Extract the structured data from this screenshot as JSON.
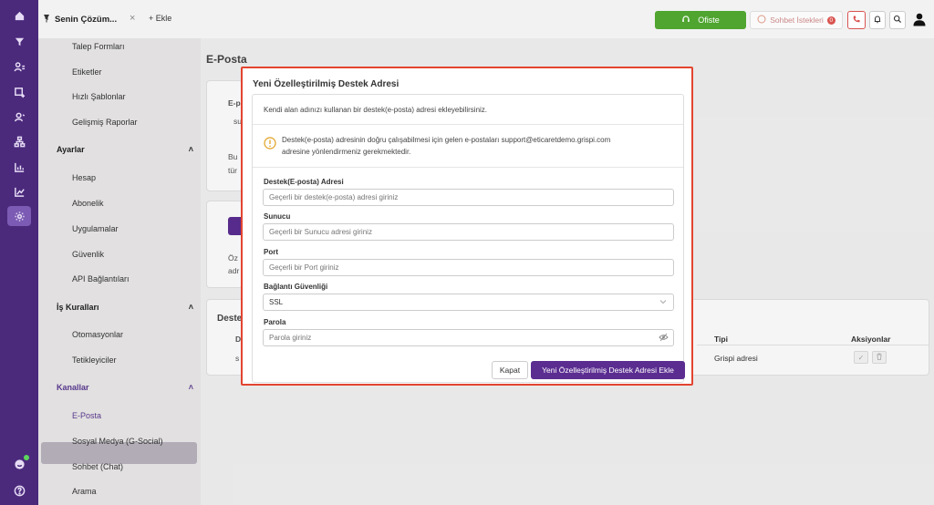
{
  "topbar": {
    "tab_title": "Senin Çözüm...",
    "tab_add": "+ Ekle",
    "ofiste_label": "Ofiste",
    "sohbet_label": "Sohbet İstekleri",
    "sohbet_count": "0"
  },
  "sidebar": {
    "items_top": [
      "Talep Formları",
      "Etiketler",
      "Hızlı Şablonlar",
      "Gelişmiş Raporlar"
    ],
    "section_ayarlar": "Ayarlar",
    "items_ayarlar": [
      "Hesap",
      "Abonelik",
      "Uygulamalar",
      "Güvenlik",
      "API Bağlantıları"
    ],
    "section_kurallar": "İş Kuralları",
    "items_kurallar": [
      "Otomasyonlar",
      "Tetikleyiciler"
    ],
    "section_kanallar": "Kanallar",
    "items_kanallar": [
      "E-Posta",
      "Sosyal Medya (G-Social)",
      "Sohbet (Chat)",
      "Arama"
    ]
  },
  "content": {
    "title": "E-Posta",
    "table_heading": "Deste",
    "col_tipi": "Tipi",
    "col_aksiyonlar": "Aksiyonlar",
    "row_tipi": "Grispi adresi",
    "partials": [
      "E-p",
      "su",
      "Bu",
      "tür",
      "Öz",
      "adr",
      "D",
      "s"
    ]
  },
  "modal": {
    "title": "Yeni Özelleştirilmiş Destek Adresi",
    "description": "Kendi alan adınızı kullanan bir destek(e-posta) adresi ekleyebilirsiniz.",
    "warning_line1": "Destek(e-posta) adresinin doğru çalışabilmesi için gelen e-postaları support@eticaretdemo.grispi.com",
    "warning_line2": "adresine yönlendirmeniz gerekmektedir.",
    "address_label": "Destek(E-posta) Adresi",
    "address_placeholder": "Geçerli bir destek(e-posta) adresi giriniz",
    "server_label": "Sunucu",
    "server_placeholder": "Geçerli bir Sunucu adresi giriniz",
    "port_label": "Port",
    "port_placeholder": "Geçerli bir Port giriniz",
    "security_label": "Bağlantı Güvenliği",
    "security_value": "SSL",
    "password_label": "Parola",
    "password_placeholder": "Parola giriniz",
    "cancel_label": "Kapat",
    "submit_label": "Yeni Özelleştirilmiş Destek Adresi Ekle"
  },
  "colors": {
    "rail": "#4b2a7c",
    "accent": "#5b2d91",
    "success": "#4fa52f",
    "danger": "#e3442f"
  }
}
